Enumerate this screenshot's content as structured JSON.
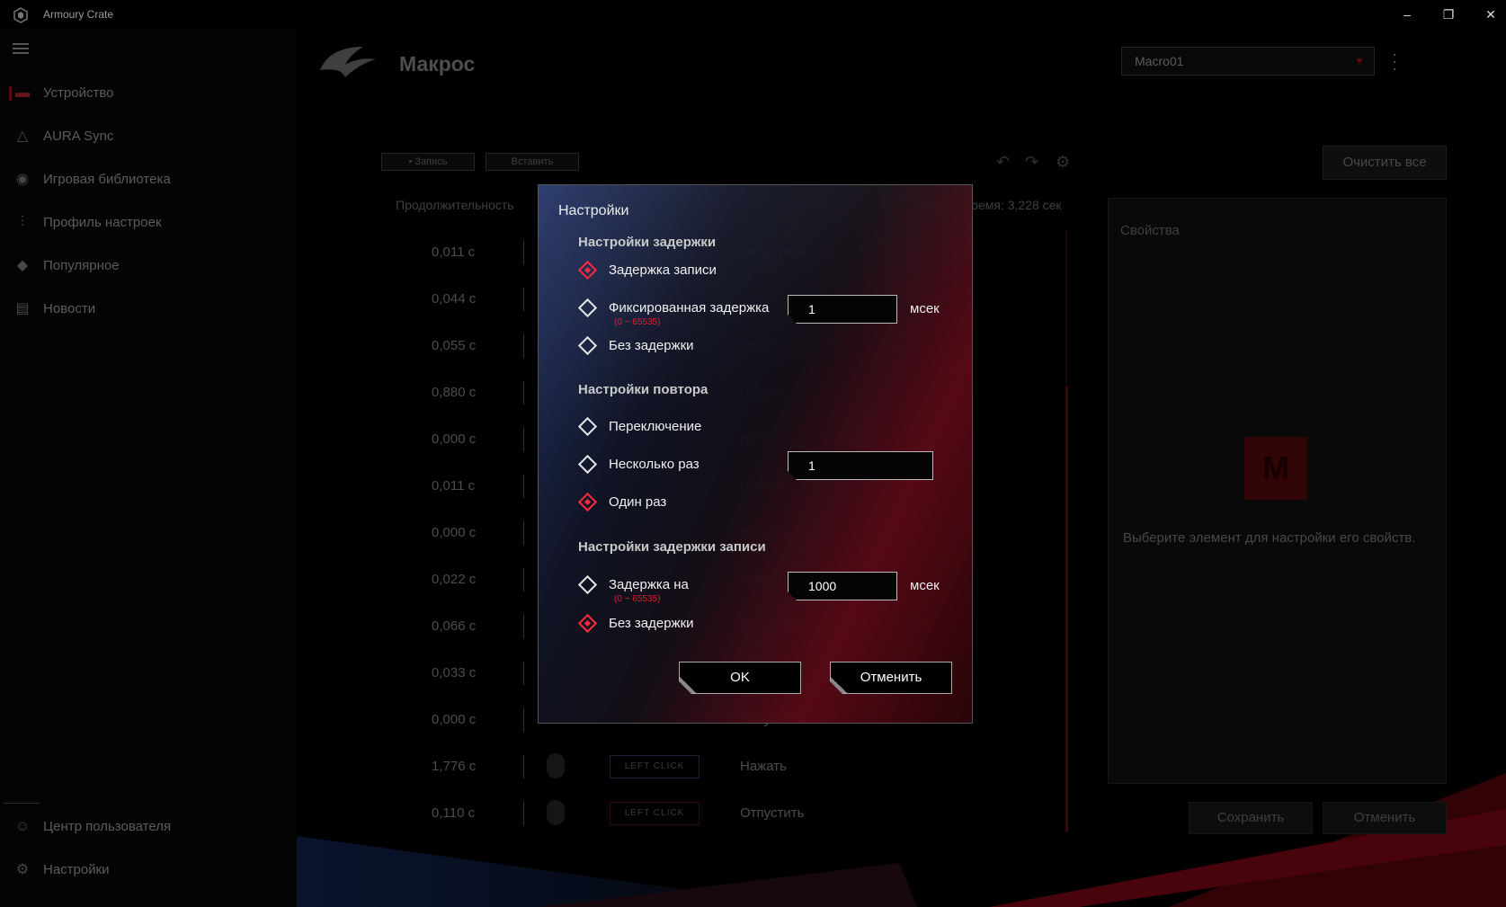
{
  "window": {
    "title": "Armoury Crate",
    "minimize_glyph": "–",
    "restore_glyph": "❐",
    "close_glyph": "✕"
  },
  "sidebar": {
    "items": [
      {
        "label": "Устройство",
        "icon": "keyboard-icon"
      },
      {
        "label": "AURA Sync",
        "icon": "aura-icon"
      },
      {
        "label": "Игровая библиотека",
        "icon": "gamepad-icon"
      },
      {
        "label": "Профиль настроек",
        "icon": "sliders-icon"
      },
      {
        "label": "Популярное",
        "icon": "tag-icon"
      },
      {
        "label": "Новости",
        "icon": "news-icon"
      }
    ],
    "bottom": [
      {
        "label": "Центр пользователя",
        "icon": "user-icon"
      },
      {
        "label": "Настройки",
        "icon": "gear-icon"
      }
    ]
  },
  "header": {
    "title": "Макрос",
    "macro_select": "Macro01"
  },
  "toolbar": {
    "record": "• Запись",
    "insert": "Вставить",
    "clear_all": "Очистить все"
  },
  "table": {
    "col_duration": "Продолжительность",
    "total_time": "Общее время: 3,228 сек",
    "rows": [
      {
        "dur": "0,011 с",
        "key": "",
        "act": "Отпустить"
      },
      {
        "dur": "0,044 с",
        "key": "",
        "act": ""
      },
      {
        "dur": "0,055 с",
        "key": "",
        "act": "Отпустить"
      },
      {
        "dur": "0,880 с",
        "key": "",
        "act": "Нажать"
      },
      {
        "dur": "0,000 с",
        "key": "",
        "act": "Нажать"
      },
      {
        "dur": "0,011 с",
        "key": "",
        "act": "Нажать"
      },
      {
        "dur": "0,000 с",
        "key": "",
        "act": "Нажать"
      },
      {
        "dur": "0,022 с",
        "key": "",
        "act": "Отпустить"
      },
      {
        "dur": "0,066 с",
        "key": "",
        "act": "Отпустить"
      },
      {
        "dur": "0,033 с",
        "key": "",
        "act": ""
      },
      {
        "dur": "0,000 с",
        "key": "",
        "act": "Отпустить"
      },
      {
        "dur": "1,776 с",
        "key": "LEFT CLICK",
        "act": "Нажать"
      },
      {
        "dur": "0,110 с",
        "key": "LEFT CLICK",
        "act": "Отпустить"
      }
    ]
  },
  "properties": {
    "title": "Свойства",
    "tile_letter": "M",
    "hint": "Выберите элемент для настройки его свойств.",
    "save": "Сохранить",
    "cancel": "Отменить"
  },
  "dialog": {
    "title": "Настройки",
    "delay_section": "Настройки задержки",
    "opt_record_delay": "Задержка записи",
    "opt_fixed_delay": "Фиксированная задержка",
    "fixed_range": "(0 ~ 65535)",
    "fixed_value": "1",
    "unit_ms": "мсек",
    "opt_no_delay": "Без задержки",
    "repeat_section": "Настройки повтора",
    "opt_toggle": "Переключение",
    "opt_multiple": "Несколько раз",
    "multiple_value": "1",
    "opt_once": "Один раз",
    "rec_delay_section": "Настройки задержки записи",
    "opt_delay_on": "Задержка на",
    "delay_on_range": "(0 ~ 65535)",
    "delay_on_value": "1000",
    "opt_rec_no_delay": "Без задержки",
    "ok": "OK",
    "cancel": "Отменить"
  },
  "colors": {
    "accent": "#ff2a3c",
    "brand_dark_red": "#6a0c12"
  }
}
